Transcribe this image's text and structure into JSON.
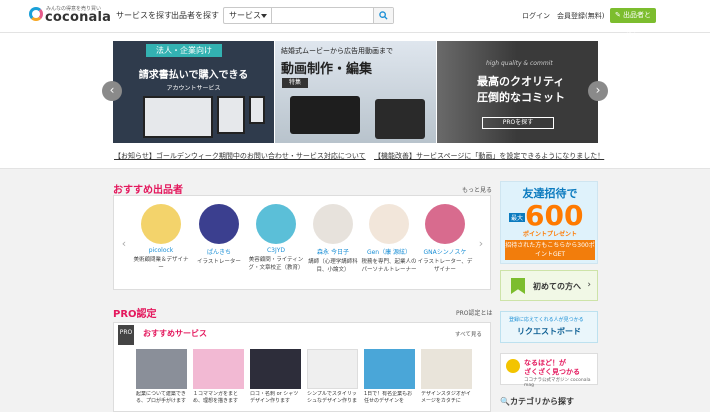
{
  "header": {
    "logo_tagline": "みんなの得意を売り買い",
    "logo_word": "coconala",
    "nav_services": "サービスを探す",
    "nav_sellers": "出品者を探す",
    "search_select": "サービス",
    "search_placeholder": "",
    "login": "ログイン",
    "signup": "会員登録(無料)",
    "seller_button": "出品者とは？"
  },
  "carousel": {
    "slide1": {
      "badge": "法人・企業向け",
      "headline": "請求書払いで購入できる",
      "sub": "アカウントサービス"
    },
    "slide2": {
      "line1": "結婚式ムービーから広告用動画まで",
      "headline": "動画制作・編集",
      "tag": "特集"
    },
    "slide3": {
      "small": "high quality & commit",
      "line1": "最高のクオリティ",
      "line2": "圧倒的なコミット",
      "button": "PROを探す"
    },
    "prev": "‹",
    "next": "›"
  },
  "notices": [
    "【お知らせ】ゴールデンウィーク期間中のお問い合わせ・サービス対応について",
    "【機能改善】サービスページに「動画」を設定できるようになりました！"
  ],
  "recommended": {
    "title": "おすすめ出品者",
    "more": "もっと見る",
    "sellers": [
      {
        "name": "picolock",
        "desc": "美術顧問業＆デザイナー",
        "color": "#f3d36b"
      },
      {
        "name": "ぱんきち",
        "desc": "イラストレーター",
        "color": "#3b3f8f"
      },
      {
        "name": "C3JYD",
        "desc": "美容顧問・ライティング・文章校正（教育）",
        "color": "#5bbfd8"
      },
      {
        "name": "森永 今日子",
        "desc": "講師（心理学講師科目、小論文）",
        "color": "#e7e2dc"
      },
      {
        "name": "Gen（康 源絃）",
        "desc": "税務を専門、起業人のパーソナルトレーナー",
        "color": "#f2e6da"
      },
      {
        "name": "GNAシンノスケ",
        "desc": "イラストレーター、デザイナー",
        "color": "#d86b8e"
      }
    ]
  },
  "pro": {
    "title": "PRO認定",
    "about": "PRO認定とは",
    "icon": "PRO",
    "services_title": "おすすめサービス",
    "all": "すべて見る",
    "thumbs": [
      {
        "caption": "起業について建築できる、プロが手がけます",
        "color": "#8a8f99"
      },
      {
        "caption": "１コママンガをまとめ、理想を描きます",
        "color": "#f2b9d3"
      },
      {
        "caption": "ロゴ・名刺 or シャツデザイン作ります",
        "color": "#2d2d3a"
      },
      {
        "caption": "シンプルでスタイリッシュなデザイン作ります",
        "color": "#efefef"
      },
      {
        "caption": "1日で！有名企業もお任せのデザインを",
        "color": "#4aa6d8"
      },
      {
        "caption": "デザインスタジオがイメージをカタチに",
        "color": "#e9e4da"
      }
    ]
  },
  "sidebar": {
    "invite_title": "友達招待で",
    "invite_max": "最大",
    "invite_number": "600",
    "invite_point": "ポイントプレゼント",
    "invite_cta": "招待された方もこちらから300ポイントGET",
    "first_time": "初めての方へ",
    "request_small": "登録に応えてくれる人が見つかる",
    "request": "リクエストボード",
    "mag_line1": "なるほど！が",
    "mag_line2": "ざくざく見つかる",
    "mag_sub": "ココナラ公式マガジン coconala mag",
    "categories": "カテゴリから探す"
  }
}
